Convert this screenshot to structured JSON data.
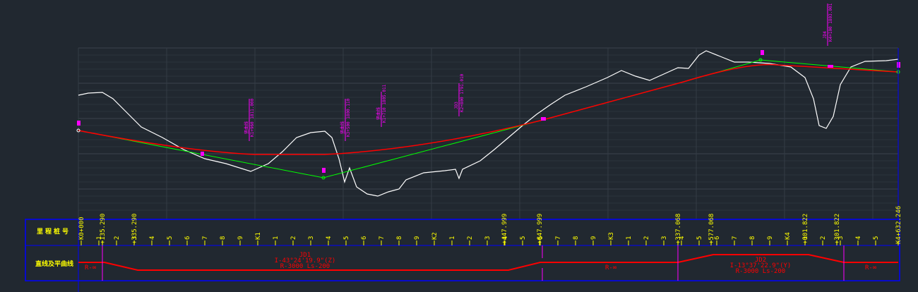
{
  "table": {
    "row1_label": "里程桩号",
    "row2_label": "直线及平曲线"
  },
  "regular_ticks": [
    "K0+000",
    "1",
    "2",
    "3",
    "4",
    "5",
    "6",
    "7",
    "8",
    "9",
    "K1",
    "1",
    "2",
    "3",
    "4",
    "5",
    "6",
    "7",
    "8",
    "9",
    "K2",
    "1",
    "2",
    "3",
    "4",
    "5",
    "6",
    "7",
    "8",
    "9",
    "K3",
    "1",
    "2",
    "3",
    "4",
    "5",
    "6",
    "7",
    "8",
    "9",
    "K4",
    "1",
    "2",
    "3",
    "4",
    "5"
  ],
  "special_stations": [
    {
      "label": "+135.290",
      "chainage": 120
    },
    {
      "label": "+335.290",
      "chainage": 300
    },
    {
      "label": "+447.999",
      "chainage": 2396
    },
    {
      "label": "+647.999",
      "chainage": 2596
    },
    {
      "label": "+337.068",
      "chainage": 3380
    },
    {
      "label": "+577.068",
      "chainage": 3568
    },
    {
      "label": "+001.822",
      "chainage": 4100
    },
    {
      "label": "+301.822",
      "chainage": 4280
    },
    {
      "label": "K4+632.246",
      "chainage": 4628
    }
  ],
  "curves": {
    "jd1": {
      "name": "JD1",
      "angle": "I-43°24'19.9\"(Z)",
      "params": "R-3000 Ls-200"
    },
    "jd2": {
      "name": "JD2",
      "angle": "I-13°37'22.9\"(Y)",
      "params": "R-3000 Ls-200"
    },
    "straight_label": "R-∞"
  },
  "profile_labels": [
    {
      "title": "竖曲线",
      "station": "K1+960 1811.000"
    },
    {
      "title": "竖曲线",
      "station": "K3+500 1800.110"
    },
    {
      "title": "竖曲线",
      "station": "K1+710 1805.011"
    },
    {
      "title": "JD3",
      "station": "K2+800 1791.010"
    },
    {
      "title": "JD4",
      "station": "K4+100 1803.001"
    }
  ],
  "colors": {
    "background": "#212830",
    "frame": "#0000ff",
    "ground": "#ffffff",
    "design": "#ff0000",
    "tangent": "#00ff00",
    "annotation": "#ff00ff",
    "text": "#ffff00"
  }
}
